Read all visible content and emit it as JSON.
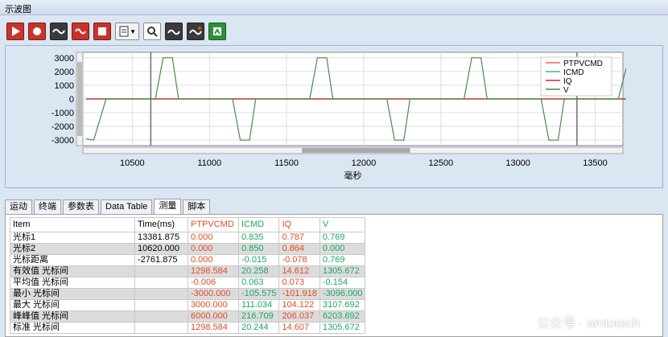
{
  "window": {
    "title": "示波图"
  },
  "toolbar": {
    "icons": [
      "run-icon",
      "stop-icon",
      "wave-icon",
      "refresh-wave-icon",
      "record-stop-icon",
      "document-icon",
      "zoom-icon",
      "cursor-wave-icon",
      "cursor-plus-icon",
      "export-icon"
    ]
  },
  "chart_data": {
    "type": "line",
    "x": [
      10200,
      10250,
      10330,
      10370,
      10400,
      10450,
      10500,
      10550,
      10600,
      10650,
      10700,
      10730,
      10760,
      10800,
      10850,
      10900,
      10950,
      11000,
      11050,
      11100,
      11150,
      11200,
      11230,
      11260,
      11300,
      11350,
      11400,
      11450,
      11500,
      11550,
      11600,
      11650,
      11700,
      11730,
      11760,
      11800,
      11850,
      11900,
      11950,
      12000,
      12050,
      12100,
      12150,
      12200,
      12230,
      12260,
      12300,
      12350,
      12400,
      12450,
      12500,
      12550,
      12600,
      12650,
      12700,
      12730,
      12760,
      12800,
      12850,
      12900,
      12950,
      13000,
      13050,
      13100,
      13150,
      13200,
      13230,
      13260,
      13300,
      13350,
      13400,
      13450,
      13500,
      13550,
      13600,
      13650,
      13700
    ],
    "series": [
      {
        "name": "PTPVCMD",
        "color": "#e26a3a",
        "values": [
          0,
          0,
          0,
          0,
          0,
          0,
          0,
          0,
          0,
          0,
          0,
          0,
          0,
          0,
          0,
          0,
          0,
          0,
          0,
          0,
          0,
          0,
          0,
          0,
          0,
          0,
          0,
          0,
          0,
          0,
          0,
          0,
          0,
          0,
          0,
          0,
          0,
          0,
          0,
          0,
          0,
          0,
          0,
          0,
          0,
          0,
          0,
          0,
          0,
          0,
          0,
          0,
          0,
          0,
          0,
          0,
          0,
          0,
          0,
          0,
          0,
          0,
          0,
          0,
          0,
          0,
          0,
          0,
          0,
          0,
          0,
          0,
          0,
          0,
          0,
          0,
          0
        ]
      },
      {
        "name": "ICMD",
        "color": "#2ec27e",
        "values": [
          0,
          0,
          0,
          0,
          0,
          0,
          0,
          0,
          0,
          0,
          0,
          0,
          0,
          0,
          0,
          0,
          0,
          0,
          0,
          0,
          0,
          0,
          0,
          0,
          0,
          0,
          0,
          0,
          0,
          0,
          0,
          0,
          0,
          0,
          0,
          0,
          0,
          0,
          0,
          0,
          0,
          0,
          0,
          0,
          0,
          0,
          0,
          0,
          0,
          0,
          0,
          0,
          0,
          0,
          0,
          0,
          0,
          0,
          0,
          0,
          0,
          0,
          0,
          0,
          0,
          0,
          0,
          0,
          0,
          0,
          0,
          0,
          0,
          0,
          0,
          0,
          0
        ]
      },
      {
        "name": "IQ",
        "color": "#c03030",
        "values": [
          0,
          0,
          0,
          0,
          0,
          0,
          0,
          0,
          0,
          0,
          0,
          0,
          0,
          0,
          0,
          0,
          0,
          0,
          0,
          0,
          0,
          0,
          0,
          0,
          0,
          0,
          0,
          0,
          0,
          0,
          0,
          0,
          0,
          0,
          0,
          0,
          0,
          0,
          0,
          0,
          0,
          0,
          0,
          0,
          0,
          0,
          0,
          0,
          0,
          0,
          0,
          0,
          0,
          0,
          0,
          0,
          0,
          0,
          0,
          0,
          0,
          0,
          0,
          0,
          0,
          0,
          0,
          0,
          0,
          0,
          0,
          0,
          0,
          0,
          0,
          0,
          0
        ]
      },
      {
        "name": "V",
        "color": "#4a8a45",
        "values": [
          -2900,
          -3000,
          0,
          0,
          0,
          0,
          0,
          0,
          0,
          0,
          3000,
          3000,
          3000,
          0,
          0,
          0,
          0,
          0,
          0,
          0,
          0,
          -3000,
          -3000,
          -3000,
          0,
          0,
          0,
          0,
          0,
          0,
          0,
          0,
          3000,
          3000,
          3000,
          0,
          0,
          0,
          0,
          0,
          0,
          0,
          0,
          -3000,
          -3000,
          -3000,
          0,
          0,
          0,
          0,
          0,
          0,
          0,
          0,
          3000,
          3000,
          3000,
          0,
          0,
          0,
          0,
          0,
          0,
          0,
          0,
          -3000,
          -3000,
          -3000,
          0,
          0,
          0,
          0,
          0,
          0,
          0,
          0,
          2200
        ]
      }
    ],
    "xlabel": "毫秒",
    "ylabel": "",
    "xlim": [
      10180,
      13680
    ],
    "ylim": [
      -3400,
      3400
    ],
    "xticks": [
      10500,
      11000,
      11500,
      12000,
      12500,
      13000,
      13500
    ],
    "yticks": [
      3000,
      2000,
      1000,
      0,
      -1000,
      -2000,
      -3000
    ],
    "cursors": [
      10620,
      13381.875
    ],
    "grid": true,
    "legend": "top-right"
  },
  "tabs": [
    "运动",
    "终端",
    "参数表",
    "Data Table",
    "测量",
    "脚本"
  ],
  "active_tab": "测量",
  "table": {
    "headers": [
      "Item",
      "Time(ms)",
      "PTPVCMD",
      "ICMD",
      "IQ",
      "V"
    ],
    "rows": [
      [
        "光标1",
        "13381.875",
        "0.000",
        "0.835",
        "0.787",
        "0.769"
      ],
      [
        "光标2",
        "10620.000",
        "0.000",
        "0.850",
        "0.864",
        "0.000"
      ],
      [
        "光标距离",
        "-2761.875",
        "0.000",
        "-0.015",
        "-0.078",
        "0.769"
      ],
      [
        "有效值 光标间",
        "",
        "1298.584",
        "20.258",
        "14.612",
        "1305.672"
      ],
      [
        "平均值 光标间",
        "",
        "-0.006",
        "0.063",
        "0.073",
        "-0.154"
      ],
      [
        "最小 光标间",
        "",
        "-3000.000",
        "-105.575",
        "-101.918",
        "-3096.000"
      ],
      [
        "最大 光标间",
        "",
        "3000.000",
        "111.034",
        "104.122",
        "3107.692"
      ],
      [
        "峰峰值 光标间",
        "",
        "6000.000",
        "216.709",
        "206.037",
        "6203.692"
      ],
      [
        "标准 光标间",
        "",
        "1298.584",
        "20.244",
        "14.607",
        "1305.672"
      ]
    ]
  },
  "watermark": "公众号 · amtotech",
  "colors": {
    "ptpvcmd": "#e34b1f",
    "icmd": "#1aa864",
    "panel": "#dbe6f3"
  }
}
